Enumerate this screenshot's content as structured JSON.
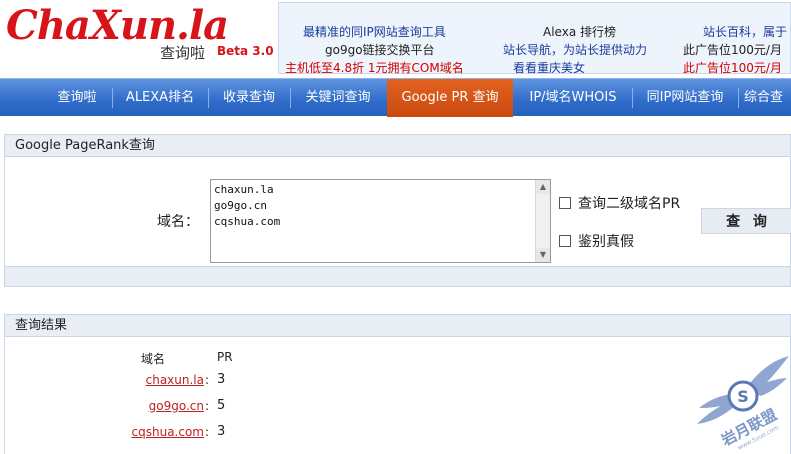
{
  "logo": {
    "main": "ChaXun.la",
    "sub": "查询啦",
    "beta": "Beta 3.0"
  },
  "ads": {
    "row1": [
      "最精准的同IP网站查询工具",
      "Alexa 排行榜",
      "站长百科，属于"
    ],
    "row2": [
      "go9go链接交换平台",
      "站长导航，为站长提供动力",
      "此广告位100元/月"
    ],
    "row3": [
      "主机低至4.8折  1元拥有COM域名",
      "看看重庆美女",
      "此广告位100元/月"
    ]
  },
  "nav": {
    "items": [
      "查询啦",
      "ALEXA排名",
      "收录查询",
      "关键词查询",
      "Google PR 查询",
      "IP/域名WHOIS",
      "同IP网站查询",
      "综合查"
    ],
    "active_index": 4
  },
  "form": {
    "title": "Google PageRank查询",
    "domain_label": "域名：",
    "domains_value": "chaxun.la\ngo9go.cn\ncqshua.com",
    "option_subdomain": "查询二级域名PR",
    "option_verify": "鉴别真假",
    "submit_label": "查 询"
  },
  "results": {
    "title": "查询结果",
    "col_domain": "域名",
    "col_pr": "PR",
    "rows": [
      {
        "domain": "chaxun.la",
        "pr": "3"
      },
      {
        "domain": "go9go.cn",
        "pr": "5"
      },
      {
        "domain": "cqshua.com",
        "pr": "3"
      }
    ]
  },
  "watermark": {
    "text": "岩月联盟",
    "url": "www.5yue.com"
  },
  "colors": {
    "brand_red": "#d7141a",
    "nav_blue": "#2f6cc9",
    "nav_active": "#d4541a",
    "link_red": "#c02020"
  }
}
